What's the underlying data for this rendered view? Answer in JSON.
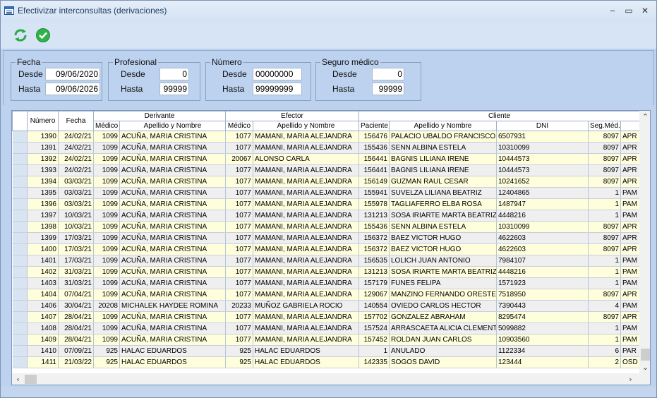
{
  "window": {
    "title": "Efectivizar interconsultas (derivaciones)",
    "minimize_glyph": "‒",
    "maximize_glyph": "▭",
    "close_glyph": "✕"
  },
  "toolbar": {
    "refresh_icon": "refresh-icon",
    "confirm_icon": "check-icon",
    "refresh_color": "#2aa84a",
    "confirm_color": "#2fb34a"
  },
  "filters": {
    "fecha": {
      "legend": "Fecha",
      "desde_label": "Desde",
      "hasta_label": "Hasta",
      "desde": "09/06/2020",
      "hasta": "09/06/2026"
    },
    "profesional": {
      "legend": "Profesional",
      "desde_label": "Desde",
      "hasta_label": "Hasta",
      "desde": "0",
      "hasta": "99999"
    },
    "numero": {
      "legend": "Número",
      "desde_label": "Desde",
      "hasta_label": "Hasta",
      "desde": "00000000",
      "hasta": "99999999"
    },
    "seguro": {
      "legend": "Seguro médico",
      "desde_label": "Desde",
      "hasta_label": "Hasta",
      "desde": "0",
      "hasta": "99999"
    }
  },
  "grid": {
    "group_headers": {
      "numero": "Número",
      "fecha": "Fecha",
      "derivante": "Derivante",
      "efector": "Efector",
      "cliente": "Cliente"
    },
    "sub_headers": {
      "medico": "Médico",
      "apellido": "Apellido y Nombre",
      "medico2": "Médico",
      "apellido2": "Apellido y Nombre",
      "paciente": "Paciente",
      "apellido3": "Apellido y Nombre",
      "dni": "DNI",
      "seg": "Seg.Méd."
    },
    "rows": [
      [
        "1390",
        "24/02/21",
        "1099",
        "ACUÑA, MARIA CRISTINA",
        "1077",
        "MAMANI, MARIA ALEJANDRA",
        "156476",
        "PALACIO UBALDO FRANCISCO",
        "6507931",
        "8097",
        "APR"
      ],
      [
        "1391",
        "24/02/21",
        "1099",
        "ACUÑA, MARIA CRISTINA",
        "1077",
        "MAMANI, MARIA ALEJANDRA",
        "155436",
        "SENN ALBINA ESTELA",
        "10310099",
        "8097",
        "APR"
      ],
      [
        "1392",
        "24/02/21",
        "1099",
        "ACUÑA, MARIA CRISTINA",
        "20067",
        "ALONSO CARLA",
        "156441",
        "BAGNIS LILIANA IRENE",
        "10444573",
        "8097",
        "APR"
      ],
      [
        "1393",
        "24/02/21",
        "1099",
        "ACUÑA, MARIA CRISTINA",
        "1077",
        "MAMANI, MARIA ALEJANDRA",
        "156441",
        "BAGNIS LILIANA IRENE",
        "10444573",
        "8097",
        "APR"
      ],
      [
        "1394",
        "03/03/21",
        "1099",
        "ACUÑA, MARIA CRISTINA",
        "1077",
        "MAMANI, MARIA ALEJANDRA",
        "156149",
        "GUZMAN RAUL CESAR",
        "10241652",
        "8097",
        "APR"
      ],
      [
        "1395",
        "03/03/21",
        "1099",
        "ACUÑA, MARIA CRISTINA",
        "1077",
        "MAMANI, MARIA ALEJANDRA",
        "155941",
        "SUVELZA LILIANA BEATRIZ",
        "12404865",
        "1",
        "PAM"
      ],
      [
        "1396",
        "03/03/21",
        "1099",
        "ACUÑA, MARIA CRISTINA",
        "1077",
        "MAMANI, MARIA ALEJANDRA",
        "155978",
        "TAGLIAFERRO ELBA ROSA",
        "1487947",
        "1",
        "PAM"
      ],
      [
        "1397",
        "10/03/21",
        "1099",
        "ACUÑA, MARIA CRISTINA",
        "1077",
        "MAMANI, MARIA ALEJANDRA",
        "131213",
        "SOSA IRIARTE MARTA BEATRIZ",
        "4448216",
        "1",
        "PAM"
      ],
      [
        "1398",
        "10/03/21",
        "1099",
        "ACUÑA, MARIA CRISTINA",
        "1077",
        "MAMANI, MARIA ALEJANDRA",
        "155436",
        "SENN ALBINA ESTELA",
        "10310099",
        "8097",
        "APR"
      ],
      [
        "1399",
        "17/03/21",
        "1099",
        "ACUÑA, MARIA CRISTINA",
        "1077",
        "MAMANI, MARIA ALEJANDRA",
        "156372",
        "BAEZ VICTOR HUGO",
        "4622603",
        "8097",
        "APR"
      ],
      [
        "1400",
        "17/03/21",
        "1099",
        "ACUÑA, MARIA CRISTINA",
        "1077",
        "MAMANI, MARIA ALEJANDRA",
        "156372",
        "BAEZ VICTOR HUGO",
        "4622603",
        "8097",
        "APR"
      ],
      [
        "1401",
        "17/03/21",
        "1099",
        "ACUÑA, MARIA CRISTINA",
        "1077",
        "MAMANI, MARIA ALEJANDRA",
        "156535",
        "LOLICH JUAN ANTONIO",
        "7984107",
        "1",
        "PAM"
      ],
      [
        "1402",
        "31/03/21",
        "1099",
        "ACUÑA, MARIA CRISTINA",
        "1077",
        "MAMANI, MARIA ALEJANDRA",
        "131213",
        "SOSA IRIARTE MARTA BEATRIZ",
        "4448216",
        "1",
        "PAM"
      ],
      [
        "1403",
        "31/03/21",
        "1099",
        "ACUÑA, MARIA CRISTINA",
        "1077",
        "MAMANI, MARIA ALEJANDRA",
        "157179",
        "FUNES FELIPA",
        "1571923",
        "1",
        "PAM"
      ],
      [
        "1404",
        "07/04/21",
        "1099",
        "ACUÑA, MARIA CRISTINA",
        "1077",
        "MAMANI, MARIA ALEJANDRA",
        "129067",
        "MANZINO FERNANDO ORESTE",
        "7518950",
        "8097",
        "APR"
      ],
      [
        "1406",
        "30/04/21",
        "20208",
        "MICHALEK HAYDEE ROMINA",
        "20233",
        "MUÑOZ GABRIELA ROCIO",
        "140554",
        "OVIEDO CARLOS HECTOR",
        "7390443",
        "4",
        "PAM"
      ],
      [
        "1407",
        "28/04/21",
        "1099",
        "ACUÑA, MARIA CRISTINA",
        "1077",
        "MAMANI, MARIA ALEJANDRA",
        "157702",
        "GONZALEZ ABRAHAM",
        "8295474",
        "8097",
        "APR"
      ],
      [
        "1408",
        "28/04/21",
        "1099",
        "ACUÑA, MARIA CRISTINA",
        "1077",
        "MAMANI, MARIA ALEJANDRA",
        "157524",
        "ARRASCAETA ALICIA CLEMENTI",
        "5099882",
        "1",
        "PAM"
      ],
      [
        "1409",
        "28/04/21",
        "1099",
        "ACUÑA, MARIA CRISTINA",
        "1077",
        "MAMANI, MARIA ALEJANDRA",
        "157452",
        "ROLDAN JUAN CARLOS",
        "10903560",
        "1",
        "PAM"
      ],
      [
        "1410",
        "07/09/21",
        "925",
        "HALAC EDUARDOS",
        "925",
        "HALAC EDUARDOS",
        "1",
        "ANULADO",
        "1122334",
        "6",
        "PAR"
      ],
      [
        "1411",
        "21/03/22",
        "925",
        "HALAC EDUARDOS",
        "925",
        "HALAC EDUARDOS",
        "142335",
        "SOGOS DAVID",
        "123444",
        "2",
        "OSD"
      ]
    ],
    "row_colors": [
      "y",
      "g",
      "y",
      "g",
      "y",
      "g",
      "y",
      "g",
      "y",
      "g",
      "y",
      "g",
      "y",
      "g",
      "y",
      "g",
      "y",
      "g",
      "y",
      "g",
      "y"
    ]
  }
}
